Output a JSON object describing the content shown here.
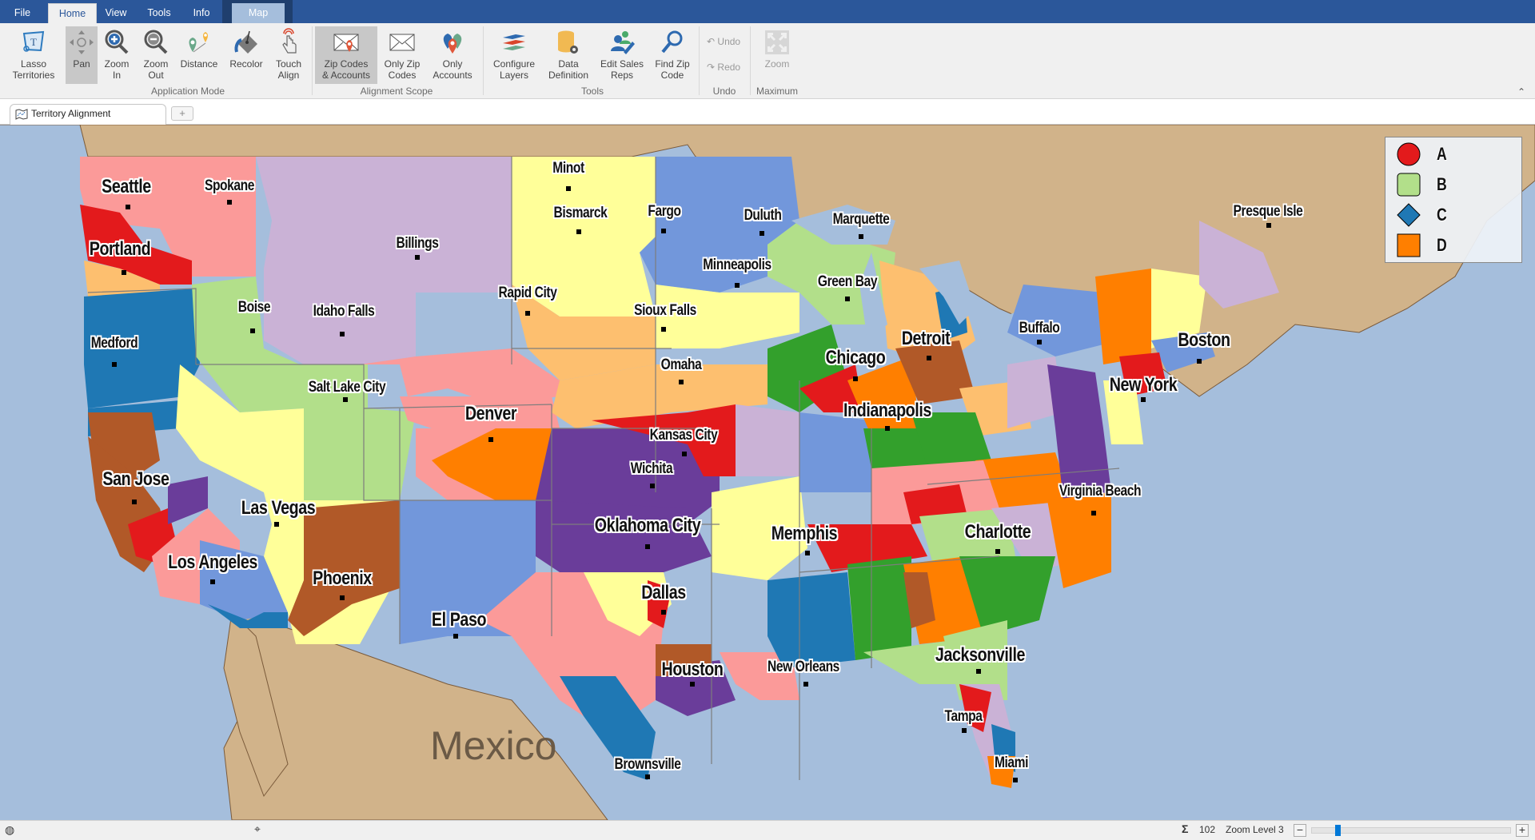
{
  "menu": {
    "tabs": [
      {
        "label": "File"
      },
      {
        "label": "Home",
        "active": true
      },
      {
        "label": "View"
      },
      {
        "label": "Tools"
      },
      {
        "label": "Info"
      }
    ],
    "context_tab": {
      "label": "Map"
    }
  },
  "ribbon": {
    "groups": {
      "application_mode": "Application Mode",
      "alignment_scope": "Alignment Scope",
      "tools": "Tools",
      "undo": "Undo",
      "maximum": "Maximum"
    },
    "buttons": {
      "lasso": {
        "label": "Lasso\nTerritories",
        "icon": "lasso-icon"
      },
      "pan": {
        "label": "Pan",
        "icon": "pan-icon",
        "selected": true
      },
      "zoom_in": {
        "label": "Zoom\nIn",
        "icon": "zoom-in-icon"
      },
      "zoom_out": {
        "label": "Zoom\nOut",
        "icon": "zoom-out-icon"
      },
      "distance": {
        "label": "Distance",
        "icon": "distance-icon"
      },
      "recolor": {
        "label": "Recolor",
        "icon": "paint-bucket-icon"
      },
      "touch_align": {
        "label": "Touch\nAlign",
        "icon": "touch-icon"
      },
      "zip_accounts": {
        "label": "Zip Codes\n& Accounts",
        "icon": "envelope-pin-icon",
        "selected": true
      },
      "only_zip": {
        "label": "Only Zip\nCodes",
        "icon": "envelope-icon"
      },
      "only_accounts": {
        "label": "Only\nAccounts",
        "icon": "map-pins-icon"
      },
      "configure_layers": {
        "label": "Configure\nLayers",
        "icon": "layers-icon"
      },
      "data_definition": {
        "label": "Data\nDefinition",
        "icon": "database-gear-icon"
      },
      "edit_sales_reps": {
        "label": "Edit Sales\nReps",
        "icon": "users-edit-icon"
      },
      "find_zip": {
        "label": "Find Zip\nCode",
        "icon": "search-icon"
      },
      "undo": {
        "label": "Undo",
        "icon": "undo-icon",
        "disabled": true
      },
      "redo": {
        "label": "Redo",
        "icon": "redo-icon",
        "disabled": true
      },
      "zoom_max": {
        "label": "Zoom",
        "icon": "maximize-icon",
        "disabled": true
      }
    }
  },
  "document": {
    "tab_label": "Territory Alignment",
    "new_tab_symbol": "+"
  },
  "map": {
    "country_label": "Mexico",
    "cities": [
      {
        "name": "Seattle",
        "size": "l"
      },
      {
        "name": "Spokane",
        "size": "m"
      },
      {
        "name": "Portland",
        "size": "l"
      },
      {
        "name": "Medford",
        "size": "m"
      },
      {
        "name": "Boise",
        "size": "m"
      },
      {
        "name": "Idaho Falls",
        "size": "m"
      },
      {
        "name": "Billings",
        "size": "m"
      },
      {
        "name": "Minot",
        "size": "m"
      },
      {
        "name": "Bismarck",
        "size": "m"
      },
      {
        "name": "Fargo",
        "size": "m"
      },
      {
        "name": "Duluth",
        "size": "m"
      },
      {
        "name": "Marquette",
        "size": "m"
      },
      {
        "name": "Minneapolis",
        "size": "m"
      },
      {
        "name": "Green Bay",
        "size": "m"
      },
      {
        "name": "Rapid City",
        "size": "m"
      },
      {
        "name": "Sioux Falls",
        "size": "m"
      },
      {
        "name": "Salt Lake City",
        "size": "m"
      },
      {
        "name": "Omaha",
        "size": "m"
      },
      {
        "name": "Chicago",
        "size": "l"
      },
      {
        "name": "Detroit",
        "size": "l"
      },
      {
        "name": "Buffalo",
        "size": "m"
      },
      {
        "name": "Presque Isle",
        "size": "m"
      },
      {
        "name": "Boston",
        "size": "l"
      },
      {
        "name": "New York",
        "size": "l"
      },
      {
        "name": "Indianapolis",
        "size": "l"
      },
      {
        "name": "Denver",
        "size": "l"
      },
      {
        "name": "Kansas City",
        "size": "m"
      },
      {
        "name": "Wichita",
        "size": "m"
      },
      {
        "name": "San Jose",
        "size": "l"
      },
      {
        "name": "Las Vegas",
        "size": "l"
      },
      {
        "name": "Virginia Beach",
        "size": "m"
      },
      {
        "name": "Oklahoma City",
        "size": "l"
      },
      {
        "name": "Memphis",
        "size": "l"
      },
      {
        "name": "Charlotte",
        "size": "l"
      },
      {
        "name": "Los Angeles",
        "size": "l"
      },
      {
        "name": "Phoenix",
        "size": "l"
      },
      {
        "name": "Dallas",
        "size": "l"
      },
      {
        "name": "El Paso",
        "size": "l"
      },
      {
        "name": "Jacksonville",
        "size": "l"
      },
      {
        "name": "Houston",
        "size": "l"
      },
      {
        "name": "New Orleans",
        "size": "m"
      },
      {
        "name": "Tampa",
        "size": "m"
      },
      {
        "name": "Brownsville",
        "size": "m"
      },
      {
        "name": "Miami",
        "size": "m"
      }
    ],
    "legend": [
      {
        "label": "A",
        "shape": "circle",
        "color": "#e31a1c"
      },
      {
        "label": "B",
        "shape": "rounded-square",
        "color": "#b2df8a"
      },
      {
        "label": "C",
        "shape": "diamond",
        "color": "#1f78b4"
      },
      {
        "label": "D",
        "shape": "square",
        "color": "#ff7f00"
      }
    ],
    "colors": {
      "water": "#a5bedc",
      "land_other": "#d1b38a",
      "red": "#e31a1c",
      "light_green": "#b2df8a",
      "blue": "#1f78b4",
      "orange": "#ff7f00",
      "pink": "#fb9a99",
      "lavender": "#cab2d6",
      "yellow": "#ffff99",
      "light_orange": "#fdbf6f",
      "cornflower": "#7297db",
      "purple": "#6a3d9a",
      "brown": "#b15928",
      "green": "#33a02c"
    }
  },
  "status": {
    "count_symbol": "Σ",
    "count": "102",
    "zoom_level_text": "Zoom Level 3",
    "zoom_fraction": 0.12,
    "zoom_minus": "−",
    "zoom_plus": "+"
  }
}
